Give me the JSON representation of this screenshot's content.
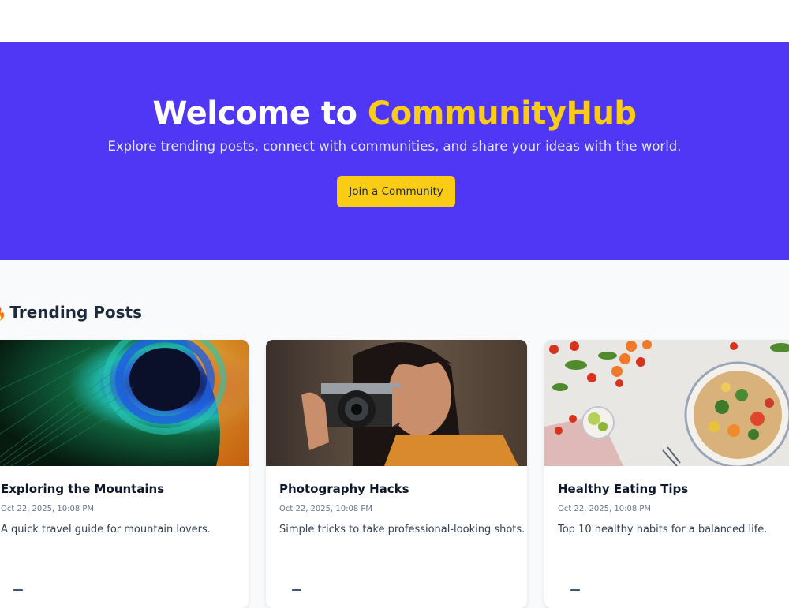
{
  "hero": {
    "title_prefix": "Welcome to ",
    "title_brand": "CommunityHub",
    "subtitle": "Explore trending posts, connect with communities, and share your ideas with the world.",
    "cta_label": "Join a Community"
  },
  "trending": {
    "heading": "Trending Posts",
    "posts": [
      {
        "title": "Exploring the Mountains",
        "date": "Oct 22, 2025, 10:08 PM",
        "description": "A quick travel guide for mountain lovers.",
        "image": "peacock-feather-photo"
      },
      {
        "title": "Photography Hacks",
        "date": "Oct 22, 2025, 10:08 PM",
        "description": "Simple tricks to take professional-looking shots.",
        "image": "woman-with-camera-photo"
      },
      {
        "title": "Healthy Eating Tips",
        "date": "Oct 22, 2025, 10:08 PM",
        "description": "Top 10 healthy habits for a balanced life.",
        "image": "healthy-salad-bowl-photo"
      }
    ]
  },
  "colors": {
    "hero_bg": "#4f37f5",
    "brand_accent": "#facc15",
    "page_bg": "#f8fafc"
  }
}
